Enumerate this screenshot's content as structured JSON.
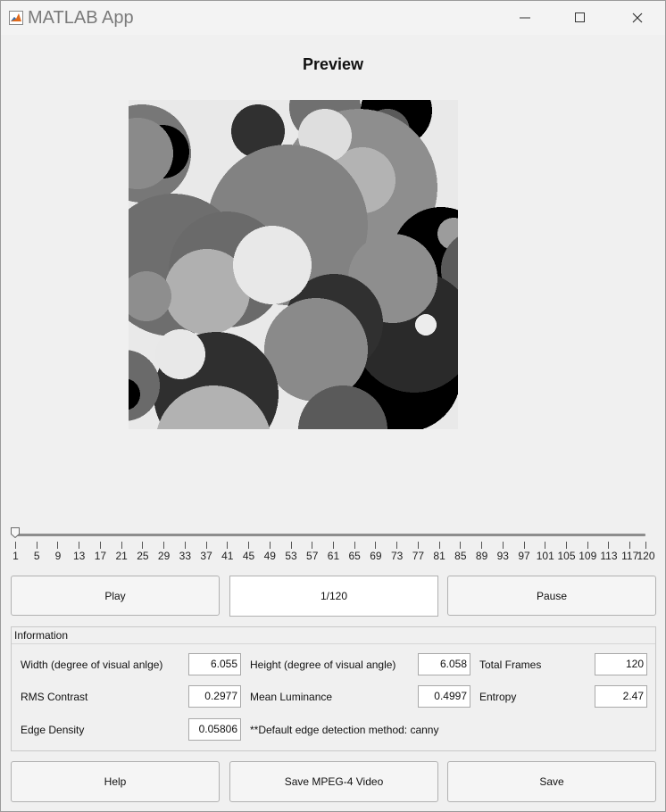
{
  "window": {
    "title": "MATLAB App"
  },
  "preview": {
    "title": "Preview"
  },
  "slider": {
    "value": 1,
    "min": 1,
    "max": 120,
    "ticks": [
      "1",
      "5",
      "9",
      "13",
      "17",
      "21",
      "25",
      "29",
      "33",
      "37",
      "41",
      "45",
      "49",
      "53",
      "57",
      "61",
      "65",
      "69",
      "73",
      "77",
      "81",
      "85",
      "89",
      "93",
      "97",
      "101",
      "105",
      "109",
      "113",
      "117",
      "120"
    ]
  },
  "controls": {
    "play_label": "Play",
    "frame_display": "1/120",
    "pause_label": "Pause"
  },
  "info": {
    "title": "Information",
    "width_label": "Width (degree of visual anlge)",
    "width_value": "6.055",
    "height_label": "Height (degree of visual angle)",
    "height_value": "6.058",
    "total_frames_label": "Total Frames",
    "total_frames_value": "120",
    "rms_label": "RMS Contrast",
    "rms_value": "0.2977",
    "lum_label": "Mean Luminance",
    "lum_value": "0.4997",
    "entropy_label": "Entropy",
    "entropy_value": "2.47",
    "edge_label": "Edge Density",
    "edge_value": "0.05806",
    "note": "**Default edge detection method: canny"
  },
  "actions": {
    "help_label": "Help",
    "save_video_label": "Save MPEG-4 Video",
    "save_label": "Save"
  }
}
